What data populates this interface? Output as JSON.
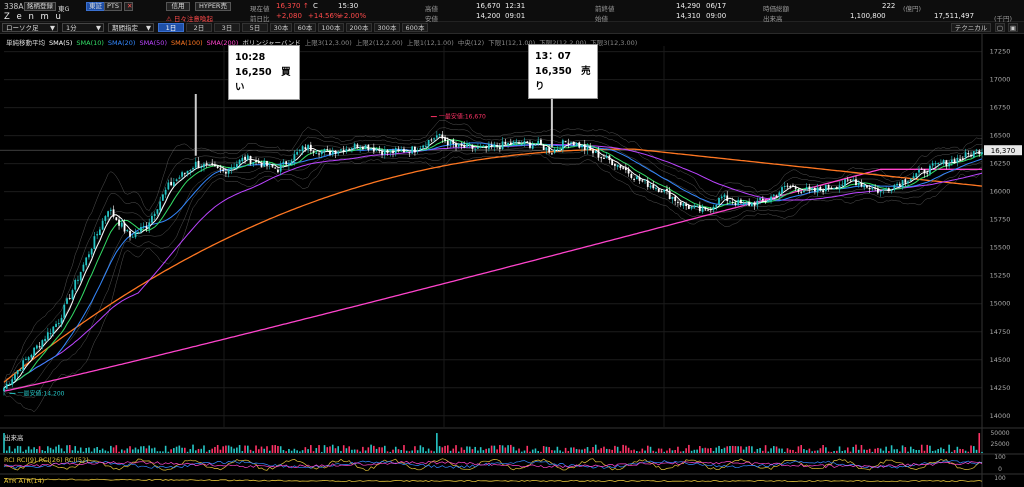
{
  "header": {
    "code": "338A",
    "watch_label": "銘柄登録",
    "market": "東G",
    "exchange": "東証",
    "pts": "PTS",
    "name": "Z e n m u",
    "margin_label": "信用",
    "hyper_label": "HYPER売",
    "alert": "⚠ 日々注意喚起",
    "current_label": "現在値",
    "current_value": "16,370",
    "current_flag": "↑",
    "current_suffix": "C",
    "current_time": "15:30",
    "prev_label": "前日比",
    "prev_value": "+2,080",
    "prev_pct": "+14.56%",
    "prev_pct2": "+2.00%",
    "high_label": "高値",
    "high_value": "16,670",
    "high_time": "12:31",
    "low_label": "安値",
    "low_value": "14,200",
    "low_time": "09:01",
    "prevclose_label": "前終値",
    "prevclose_value": "14,290",
    "prevclose_date": "06/17",
    "open_label": "始値",
    "open_value": "14,310",
    "open_time": "09:00",
    "mcap_label": "時価総額",
    "mcap_value": "222",
    "mcap_unit": "(億円)",
    "volume_label": "出来高",
    "volume_value": "1,100,800",
    "turnover_value": "17,511,497",
    "turnover_unit": "(千円)"
  },
  "toolbar": {
    "chart_type": "ローソク足",
    "interval": "1分",
    "period": "期間指定",
    "span_buttons": [
      "1日",
      "2日",
      "3日",
      "5日",
      "30本",
      "60本",
      "100本",
      "200本",
      "300本",
      "600本"
    ],
    "active_span": 0,
    "technical": "テクニカル"
  },
  "legend": [
    {
      "text": "単純移動平均",
      "color": "#dddddd"
    },
    {
      "text": "SMA(5)",
      "color": "#ffffff"
    },
    {
      "text": "SMA(10)",
      "color": "#33dd66"
    },
    {
      "text": "SMA(20)",
      "color": "#3388ff"
    },
    {
      "text": "SMA(50)",
      "color": "#bb44ff"
    },
    {
      "text": "SMA(100)",
      "color": "#ff7722"
    },
    {
      "text": "SMA(200)",
      "color": "#ff44cc"
    },
    {
      "text": "ボリンジャーバンド",
      "color": "#dddddd"
    },
    {
      "text": "上限3(12,3.00)",
      "color": "#888888"
    },
    {
      "text": "上限2(12,2.00)",
      "color": "#888888"
    },
    {
      "text": "上限1(12,1.00)",
      "color": "#888888"
    },
    {
      "text": "中央(12)",
      "color": "#888888"
    },
    {
      "text": "下限1(12,1.00)",
      "color": "#888888"
    },
    {
      "text": "下限2(12,2.00)",
      "color": "#888888"
    },
    {
      "text": "下限3(12,3.00)",
      "color": "#888888"
    }
  ],
  "callouts": [
    {
      "time": "10:28",
      "text": "16,250　買い",
      "x_index": 70
    },
    {
      "time": "13：07",
      "text": "16,350　売り",
      "x_index": 200
    }
  ],
  "annotations": {
    "high_mark": "一最安値:16,670",
    "low_mark": "一最安値:14,200"
  },
  "current_price_tag": "16,370",
  "panels": {
    "volume": "出来高",
    "rci": "RCI RCI(9) RCI(26) RCI(52)",
    "atr": "ATR ATR(14)"
  },
  "colors": {
    "up": "#26c6c6",
    "down": "#ffffff",
    "sma5": "#ffffff",
    "sma10": "#33dd66",
    "sma20": "#3388ff",
    "sma50": "#bb44ff",
    "sma100": "#ff7722",
    "sma200": "#ff44cc",
    "bb": "#777777"
  },
  "chart_data": {
    "type": "candlestick",
    "ylim": [
      13900,
      17300
    ],
    "yticks": [
      17250,
      17000,
      16750,
      16500,
      16250,
      16000,
      15750,
      15500,
      15250,
      15000,
      14750,
      14500,
      14250,
      14000
    ],
    "anchors": [
      [
        0,
        14250
      ],
      [
        8,
        14500
      ],
      [
        20,
        14850
      ],
      [
        30,
        15400
      ],
      [
        38,
        15850
      ],
      [
        46,
        15600
      ],
      [
        52,
        15700
      ],
      [
        60,
        16050
      ],
      [
        70,
        16250
      ],
      [
        80,
        16180
      ],
      [
        88,
        16300
      ],
      [
        100,
        16200
      ],
      [
        110,
        16400
      ],
      [
        118,
        16350
      ],
      [
        130,
        16420
      ],
      [
        140,
        16350
      ],
      [
        150,
        16380
      ],
      [
        158,
        16500
      ],
      [
        165,
        16400
      ],
      [
        175,
        16380
      ],
      [
        185,
        16430
      ],
      [
        195,
        16420
      ],
      [
        200,
        16360
      ],
      [
        206,
        16460
      ],
      [
        215,
        16350
      ],
      [
        225,
        16230
      ],
      [
        232,
        16100
      ],
      [
        240,
        16020
      ],
      [
        248,
        15880
      ],
      [
        256,
        15820
      ],
      [
        262,
        15950
      ],
      [
        270,
        15880
      ],
      [
        278,
        15920
      ],
      [
        286,
        16050
      ],
      [
        295,
        16000
      ],
      [
        303,
        16050
      ],
      [
        310,
        16100
      ],
      [
        320,
        16000
      ],
      [
        330,
        16120
      ],
      [
        340,
        16230
      ],
      [
        349,
        16300
      ],
      [
        356,
        16370
      ]
    ],
    "volume_max": 58000
  },
  "volume_axis": [
    "50000",
    "25000"
  ],
  "rci_axis": [
    "100",
    "0"
  ],
  "atr_axis": [
    "100"
  ]
}
